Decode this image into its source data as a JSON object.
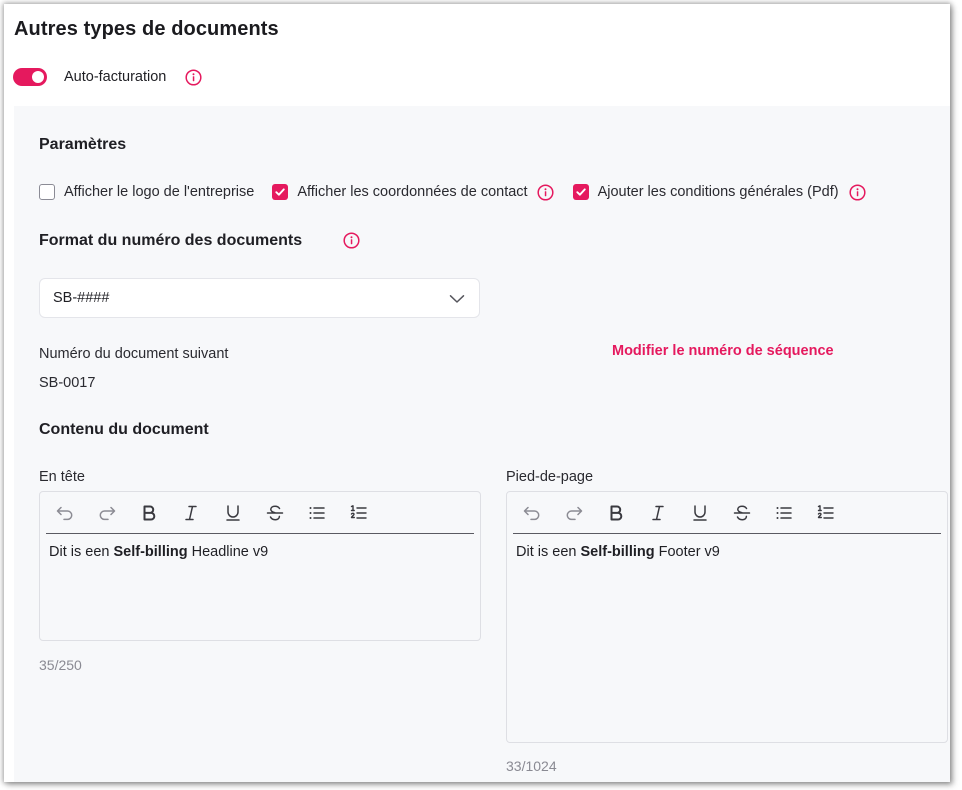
{
  "page": {
    "title": "Autres types de documents"
  },
  "toggle": {
    "label": "Auto-facturation",
    "enabled": true,
    "icon": "info-icon"
  },
  "panel": {
    "parameters": {
      "title": "Paramètres",
      "checkboxes": [
        {
          "label": "Afficher le logo de l'entreprise",
          "checked": false,
          "info": false
        },
        {
          "label": "Afficher les coordonnées de contact",
          "checked": true,
          "info": true
        },
        {
          "label": "Ajouter les conditions générales (Pdf)",
          "checked": true,
          "info": true
        }
      ]
    },
    "format": {
      "title": "Format du numéro des documents",
      "select_value": "SB-####",
      "select_icon": "chevron-down-icon"
    },
    "next_number": {
      "label": "Numéro du document suivant",
      "value": "SB-0017",
      "modify_link": "Modifier le numéro de séquence"
    },
    "content": {
      "title": "Contenu du document",
      "header": {
        "label": "En tête",
        "text_before": "Dit is een ",
        "text_bold": "Self-billing",
        "text_after": " Headline v9",
        "counter": "35/250"
      },
      "footer": {
        "label": "Pied-de-page",
        "text_before": "Dit is een ",
        "text_bold": "Self-billing",
        "text_after": " Footer v9",
        "counter": "33/1024"
      },
      "toolbar_icons": [
        "undo-icon",
        "redo-icon",
        "bold-icon",
        "italic-icon",
        "underline-icon",
        "strikethrough-icon",
        "bullet-list-icon",
        "numbered-list-icon"
      ]
    }
  },
  "colors": {
    "accent": "#e5195e",
    "panel_bg": "#f7f8fa",
    "muted_text": "#8a8a93"
  }
}
